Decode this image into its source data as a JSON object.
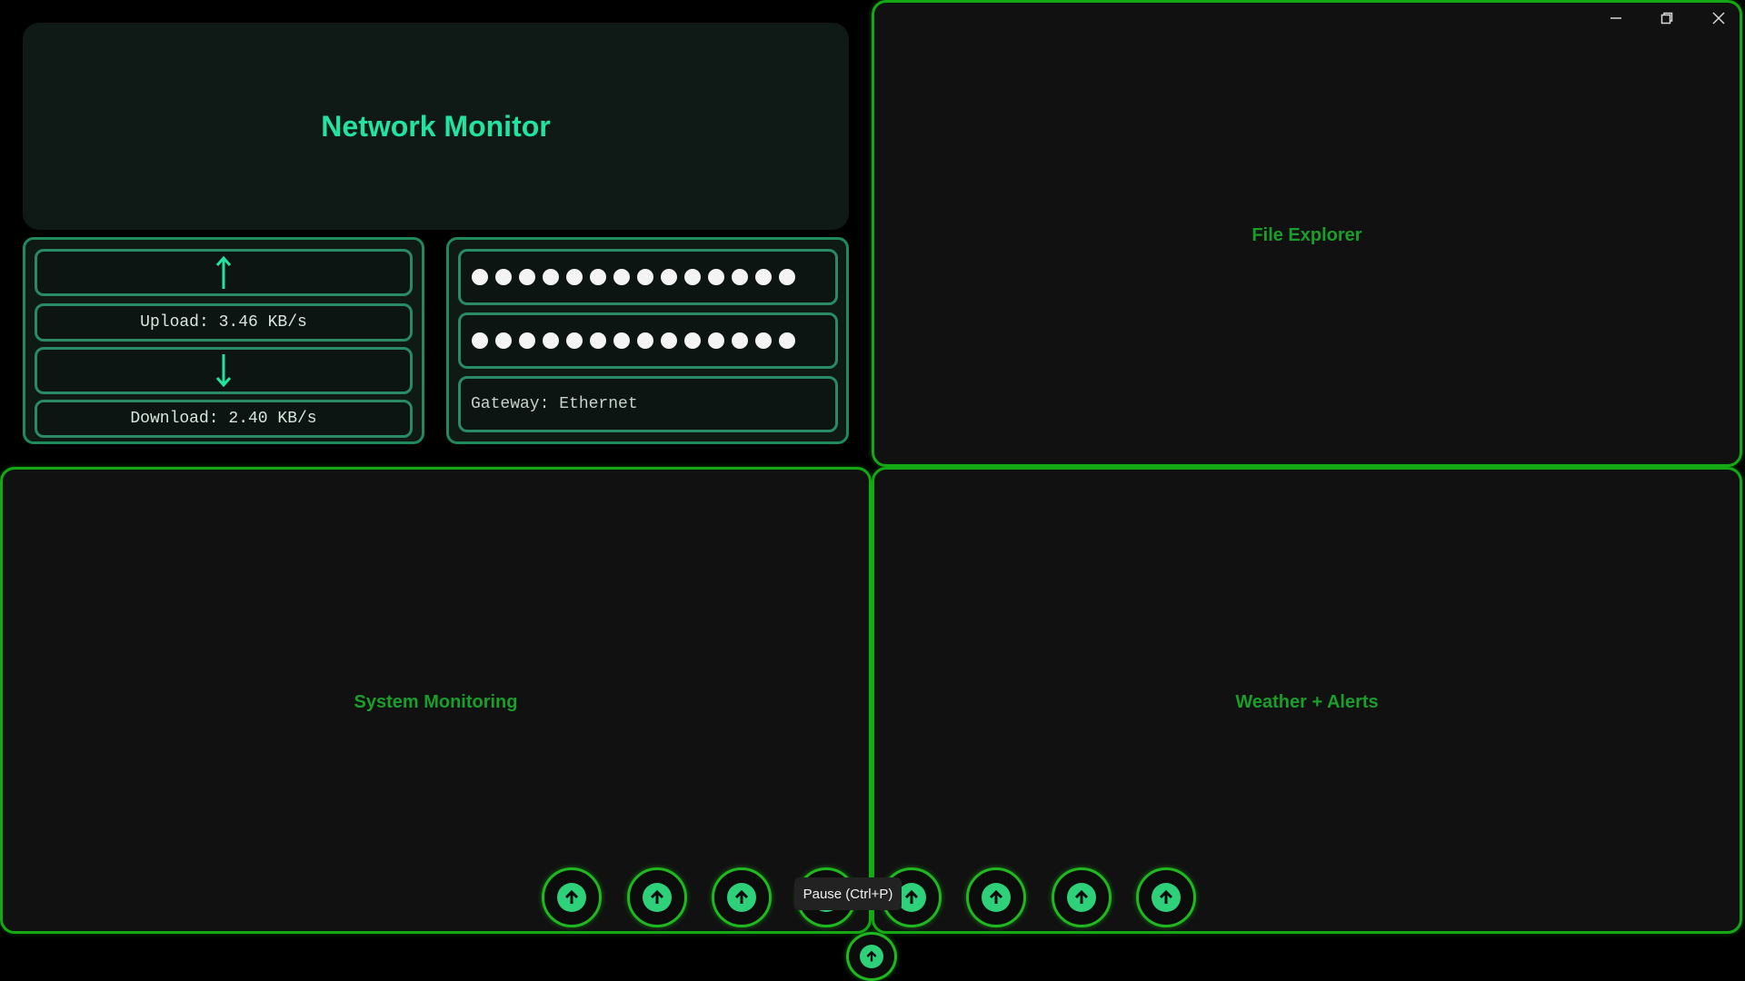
{
  "window_controls": {
    "minimize_icon": "minimize-icon",
    "restore_icon": "restore-icon",
    "close_icon": "close-icon"
  },
  "network_monitor": {
    "title": "Network Monitor",
    "upload_label": "Upload: 3.46 KB/s",
    "download_label": "Download: 2.40 KB/s",
    "address_masked_1": "●●●●●●●●●●●●●●",
    "address_masked_2": "●●●●●●●●●●●●●●",
    "gateway_label": "Gateway: Ethernet"
  },
  "panels": {
    "file_explorer": "File Explorer",
    "system_monitoring": "System Monitoring",
    "weather_alerts": "Weather + Alerts"
  },
  "dock": {
    "buttons": [
      "up-arrow-icon",
      "up-arrow-icon",
      "up-arrow-icon",
      "up-arrow-icon",
      "up-arrow-icon",
      "up-arrow-icon",
      "up-arrow-icon",
      "up-arrow-icon"
    ],
    "bottom_button": "up-arrow-icon",
    "tooltip": "Pause (Ctrl+P)"
  },
  "colors": {
    "accent": "#22e3a2",
    "border_green": "#14a814",
    "label_green": "#1a9e2a"
  }
}
